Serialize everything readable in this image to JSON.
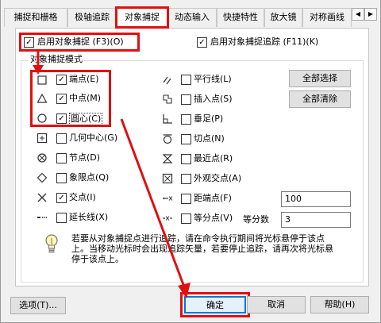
{
  "tabs": [
    "捕捉和栅格",
    "极轴追踪",
    "对象捕捉",
    "动态输入",
    "快捷特性",
    "放大镜",
    "对称画线"
  ],
  "tab_nav": {
    "left": "◀",
    "right": "▶"
  },
  "panel": {
    "enable_snap": "启用对象捕捉 (F3)(O)",
    "enable_track": "启用对象捕捉追踪 (F11)(K)",
    "group_title": "对象捕捉模式",
    "modes_left": [
      {
        "label": "端点(E)",
        "checked": "✓"
      },
      {
        "label": "中点(M)",
        "checked": "✓"
      },
      {
        "label": "圆心(C)",
        "checked": "✓"
      },
      {
        "label": "几何中心(G)",
        "checked": ""
      },
      {
        "label": "节点(D)",
        "checked": ""
      },
      {
        "label": "象限点(Q)",
        "checked": ""
      },
      {
        "label": "交点(I)",
        "checked": "✓"
      },
      {
        "label": "延长线(X)",
        "checked": ""
      }
    ],
    "modes_right": [
      {
        "label": "平行线(L)",
        "checked": ""
      },
      {
        "label": "插入点(S)",
        "checked": ""
      },
      {
        "label": "垂足(P)",
        "checked": ""
      },
      {
        "label": "切点(N)",
        "checked": ""
      },
      {
        "label": "最近点(R)",
        "checked": ""
      },
      {
        "label": "外观交点(A)",
        "checked": ""
      },
      {
        "label": "距端点(F)",
        "checked": ""
      },
      {
        "label": "等分点(V)",
        "checked": ""
      }
    ],
    "select_all": "全部选择",
    "clear_all": "全部清除",
    "distance_value": "100",
    "divide_label": "等分数",
    "divide_value": "3",
    "hint": "若要从对象捕捉点进行追踪，请在命令执行期间将光标悬停于该点上。当移动光标时会出现追踪矢量，若要停止追踪，请再次将光标悬停于该点上。"
  },
  "footer": {
    "options": "选项(T)...",
    "ok": "确定",
    "cancel": "取消",
    "help": "帮助(H)"
  }
}
